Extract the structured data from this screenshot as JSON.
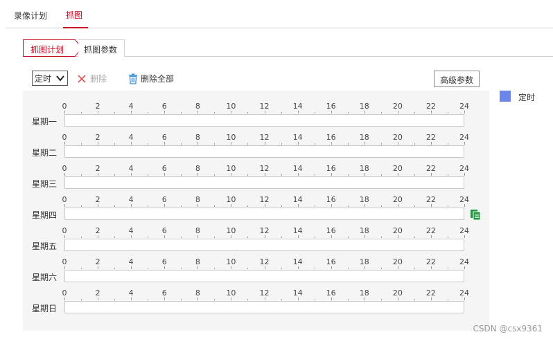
{
  "top_tabs": [
    {
      "label": "录像计划",
      "active": false
    },
    {
      "label": "抓图",
      "active": true
    }
  ],
  "sub_tabs": [
    {
      "label": "抓图计划",
      "active": true
    },
    {
      "label": "抓图参数",
      "active": false
    }
  ],
  "toolbar": {
    "mode_select_value": "定时",
    "delete_label": "删除",
    "delete_all_label": "删除全部",
    "advanced_label": "高级参数"
  },
  "legend": {
    "label": "定时",
    "color": "#6a86e8"
  },
  "timeline_ticks": [
    "0",
    "2",
    "4",
    "6",
    "8",
    "10",
    "12",
    "14",
    "16",
    "18",
    "20",
    "22",
    "24"
  ],
  "days": [
    {
      "label": "星期一",
      "schedule": []
    },
    {
      "label": "星期二",
      "schedule": []
    },
    {
      "label": "星期三",
      "schedule": []
    },
    {
      "label": "星期四",
      "schedule": []
    },
    {
      "label": "星期五",
      "schedule": []
    },
    {
      "label": "星期六",
      "schedule": []
    },
    {
      "label": "星期日",
      "schedule": []
    }
  ],
  "watermark": "CSDN @csx9361",
  "colors": {
    "accent": "#d0021b",
    "legend_timed": "#6a86e8",
    "copy_icon": "#1a9a3a",
    "delete_icon": "#e05050",
    "delete_all_icon": "#3a8ed8"
  }
}
